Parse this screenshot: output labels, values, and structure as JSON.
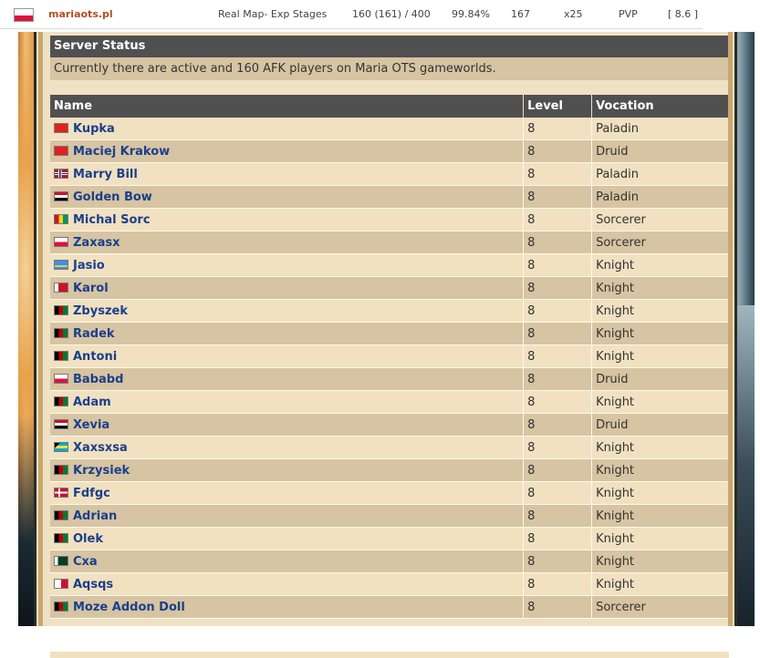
{
  "server_row": {
    "name": "mariaots.pl",
    "map": "Real Map- Exp Stages",
    "players": "160 (161) / 400",
    "uptime": "99.84%",
    "count": "167",
    "rate": "x25",
    "type": "PVP",
    "version": "[ 8.6 ]"
  },
  "status": {
    "title": "Server Status",
    "text": "Currently there are active and 160 AFK players on Maria OTS gameworlds."
  },
  "table": {
    "headers": {
      "name": "Name",
      "level": "Level",
      "vocation": "Vocation"
    },
    "rows": [
      {
        "name": "Kupka",
        "level": "8",
        "vocation": "Paladin",
        "flag": "vn"
      },
      {
        "name": "Maciej Krakow",
        "level": "8",
        "vocation": "Druid",
        "flag": "al"
      },
      {
        "name": "Marry Bill",
        "level": "8",
        "vocation": "Paladin",
        "flag": "no"
      },
      {
        "name": "Golden Bow",
        "level": "8",
        "vocation": "Paladin",
        "flag": "iq"
      },
      {
        "name": "Michal Sorc",
        "level": "8",
        "vocation": "Sorcerer",
        "flag": "gn"
      },
      {
        "name": "Zaxasx",
        "level": "8",
        "vocation": "Sorcerer",
        "flag": "pl"
      },
      {
        "name": "Jasio",
        "level": "8",
        "vocation": "Knight",
        "flag": "aw"
      },
      {
        "name": "Karol",
        "level": "8",
        "vocation": "Knight",
        "flag": "bh"
      },
      {
        "name": "Zbyszek",
        "level": "8",
        "vocation": "Knight",
        "flag": "af"
      },
      {
        "name": "Radek",
        "level": "8",
        "vocation": "Knight",
        "flag": "af"
      },
      {
        "name": "Antoni",
        "level": "8",
        "vocation": "Knight",
        "flag": "af"
      },
      {
        "name": "Bababd",
        "level": "8",
        "vocation": "Druid",
        "flag": "pl"
      },
      {
        "name": "Adam",
        "level": "8",
        "vocation": "Knight",
        "flag": "af"
      },
      {
        "name": "Xevia",
        "level": "8",
        "vocation": "Druid",
        "flag": "sy"
      },
      {
        "name": "Xaxsxsa",
        "level": "8",
        "vocation": "Knight",
        "flag": "bs"
      },
      {
        "name": "Krzysiek",
        "level": "8",
        "vocation": "Knight",
        "flag": "af"
      },
      {
        "name": "Fdfgc",
        "level": "8",
        "vocation": "Knight",
        "flag": "dk"
      },
      {
        "name": "Adrian",
        "level": "8",
        "vocation": "Knight",
        "flag": "af"
      },
      {
        "name": "Olek",
        "level": "8",
        "vocation": "Knight",
        "flag": "af"
      },
      {
        "name": "Cxa",
        "level": "8",
        "vocation": "Knight",
        "flag": "pk"
      },
      {
        "name": "Aqsqs",
        "level": "8",
        "vocation": "Knight",
        "flag": "pa"
      },
      {
        "name": "Moze Addon Doll",
        "level": "8",
        "vocation": "Sorcerer",
        "flag": "af"
      }
    ]
  },
  "flag_styles": {
    "vn": "background:#da251d",
    "al": "background:#e41e20",
    "no": "background:linear-gradient(90deg,transparent 30%,#fff 30%,#fff 36%,#00205b 36%,#00205b 48%,#fff 48%,#fff 54%,transparent 54%),linear-gradient(180deg,transparent 36%,#fff 36%,#fff 42%,#00205b 42%,#00205b 58%,#fff 58%,#fff 64%,transparent 64%),#ba0c2f",
    "iq": "background:linear-gradient(180deg,#ce1126 33%,#fff 33%,#fff 66%,#000 66%)",
    "gn": "background:linear-gradient(90deg,#ce1126 33%,#fcd116 33%,#fcd116 66%,#009460 66%)",
    "pl": "background:linear-gradient(180deg,#fff 50%,#dc143c 50%)",
    "aw": "background:linear-gradient(180deg,#418fde 60%,#fff 60%,#fff 68%,#ffd100 68%,#ffd100 76%,#418fde 76%)",
    "bh": "background:linear-gradient(90deg,#fff 30%,#ce1126 30%)",
    "af": "background:linear-gradient(90deg,#000 33%,#be0000 33%,#be0000 66%,#007a36 66%)",
    "sy": "background:linear-gradient(180deg,#ce1126 33%,#fff 33%,#fff 66%,#000 66%)",
    "bs": "background:linear-gradient(135deg,#000 25%,transparent 25%),linear-gradient(180deg,#00abc9 33%,#fae042 33%,#fae042 66%,#00abc9 66%)",
    "dk": "background:linear-gradient(90deg,transparent 30%,#fff 30%,#fff 42%,transparent 42%),linear-gradient(180deg,transparent 40%,#fff 40%,#fff 60%,transparent 60%),#c8102e",
    "pk": "background:linear-gradient(90deg,#fff 25%,#01411c 25%)",
    "pa": "background:linear-gradient(90deg,#fff 50%,#d21034 50%),#fff"
  },
  "colors": {
    "name_link": "#1b3f8b",
    "server_link": "#b3501d",
    "header_bg": "#505050",
    "row_light": "#f1e1c1",
    "row_dark": "#d6c4a2"
  }
}
